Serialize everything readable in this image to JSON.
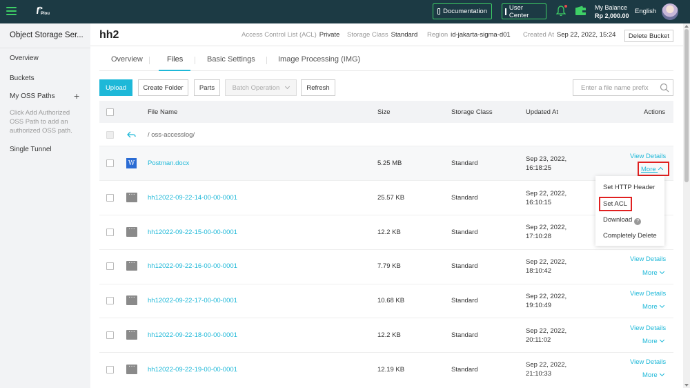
{
  "topbar": {
    "documentation_label": "Documentation",
    "user_center_label": "User Center",
    "balance_label": "My Balance",
    "balance_value": "Rp 2,000.00",
    "language": "English",
    "logo_text": "Plou",
    "accent": "#3ecf66",
    "bg": "#1c3a44"
  },
  "sidebar": {
    "title": "Object Storage Ser...",
    "items": [
      {
        "label": "Overview"
      },
      {
        "label": "Buckets"
      },
      {
        "label": "My OSS Paths"
      },
      {
        "label": "Single Tunnel"
      }
    ],
    "hint": "Click Add Authorized OSS Path to add an authorized OSS path."
  },
  "bucket": {
    "name": "hh2",
    "acl_label": "Access Control List (ACL)",
    "acl_value": "Private",
    "storage_class_label": "Storage Class",
    "storage_class_value": "Standard",
    "region_label": "Region",
    "region_value": "id-jakarta-sigma-d01",
    "created_label": "Created At",
    "created_value": "Sep 22, 2022, 15:24",
    "delete_label": "Delete Bucket"
  },
  "tabs": [
    {
      "label": "Overview"
    },
    {
      "label": "Files",
      "active": true
    },
    {
      "label": "Basic Settings"
    },
    {
      "label": "Image Processing (IMG)"
    }
  ],
  "toolbar": {
    "upload": "Upload",
    "create_folder": "Create Folder",
    "parts": "Parts",
    "batch_operation": "Batch Operation",
    "refresh": "Refresh",
    "search_placeholder": "Enter a file name prefix"
  },
  "table": {
    "columns": [
      "File Name",
      "Size",
      "Storage Class",
      "Updated At",
      "Actions"
    ],
    "parent_path": "/ oss-accesslog/",
    "rows": [
      {
        "name": "Postman.docx",
        "size": "5.25 MB",
        "storage_class": "Standard",
        "date": "Sep 23, 2022,",
        "time": "16:18:25",
        "type": "word"
      },
      {
        "name": "hh12022-09-22-14-00-00-0001",
        "size": "25.57 KB",
        "storage_class": "Standard",
        "date": "Sep 22, 2022,",
        "time": "16:10:15",
        "type": "file"
      },
      {
        "name": "hh12022-09-22-15-00-00-0001",
        "size": "12.2 KB",
        "storage_class": "Standard",
        "date": "Sep 22, 2022,",
        "time": "17:10:28",
        "type": "file"
      },
      {
        "name": "hh12022-09-22-16-00-00-0001",
        "size": "7.79 KB",
        "storage_class": "Standard",
        "date": "Sep 22, 2022,",
        "time": "18:10:42",
        "type": "file"
      },
      {
        "name": "hh12022-09-22-17-00-00-0001",
        "size": "10.68 KB",
        "storage_class": "Standard",
        "date": "Sep 22, 2022,",
        "time": "19:10:49",
        "type": "file"
      },
      {
        "name": "hh12022-09-22-18-00-00-0001",
        "size": "12.2 KB",
        "storage_class": "Standard",
        "date": "Sep 22, 2022,",
        "time": "20:11:02",
        "type": "file"
      },
      {
        "name": "hh12022-09-22-19-00-00-0001",
        "size": "12.19 KB",
        "storage_class": "Standard",
        "date": "Sep 22, 2022,",
        "time": "21:10:33",
        "type": "file"
      }
    ],
    "view_details": "View Details",
    "more": "More"
  },
  "dropdown": {
    "items": [
      {
        "label": "Set HTTP Header"
      },
      {
        "label": "Set ACL"
      },
      {
        "label": "Download"
      },
      {
        "label": "Completely Delete"
      }
    ]
  }
}
